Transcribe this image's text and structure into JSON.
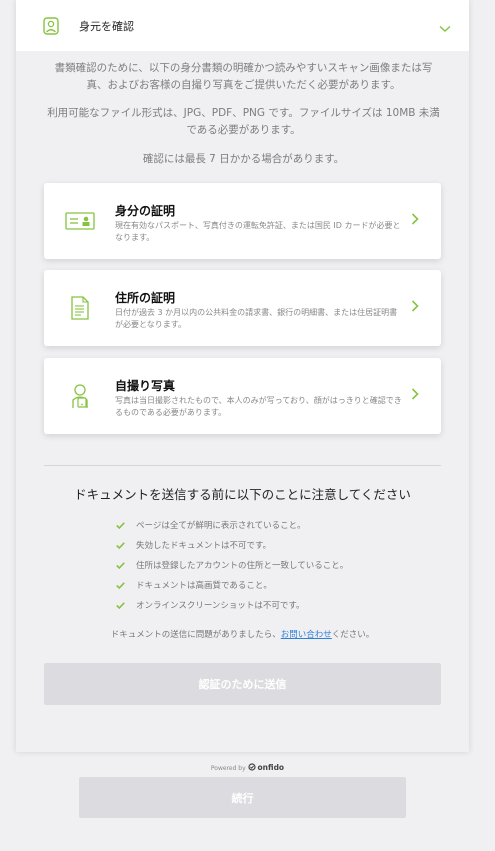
{
  "header": {
    "title": "身元を確認",
    "icon": "person-outline-icon",
    "expand_icon": "chevron-down-icon"
  },
  "intro": {
    "paragraph1": "書類確認のために、以下の身分書類の明確かつ読みやすいスキャン画像または写真、およびお客様の自撮り写真をご提供いただく必要があります。",
    "paragraph2": "利用可能なファイル形式は、JPG、PDF、PNG です。ファイルサイズは 10MB 未満である必要があります。",
    "paragraph3": "確認には最長 7 日かかる場合があります。"
  },
  "cards": [
    {
      "title": "身分の証明",
      "description": "現在有効なパスポート、写真付きの運転免許証、または国民 ID カードが必要となります。",
      "icon": "id-card-icon"
    },
    {
      "title": "住所の証明",
      "description": "日付が過去 3 か月以内の公共料金の請求書、銀行の明細書、または住居証明書が必要となります。",
      "icon": "document-icon"
    },
    {
      "title": "自撮り写真",
      "description": "写真は当日撮影されたもので、本人のみが写っており、顔がはっきりと確認できるものである必要があります。",
      "icon": "selfie-icon"
    }
  ],
  "notice": {
    "title": "ドキュメントを送信する前に以下のことに注意してください",
    "items": [
      "ページは全てが鮮明に表示されていること。",
      "失効したドキュメントは不可です。",
      "住所は登録したアカウントの住所と一致していること。",
      "ドキュメントは高画質であること。",
      "オンラインスクリーンショットは不可です。"
    ]
  },
  "help": {
    "prefix": "ドキュメントの送信に問題がありましたら、",
    "link": "お問い合わせ",
    "suffix": "ください。"
  },
  "submit_label": "認証のために送信",
  "powered_by": {
    "prefix": "Powered by",
    "brand": "onfido"
  },
  "continue_label": "続行",
  "colors": {
    "accent": "#85c441",
    "link": "#2f7fd4",
    "disabled_button": "#dcdce0",
    "background": "#f0f0f3"
  }
}
